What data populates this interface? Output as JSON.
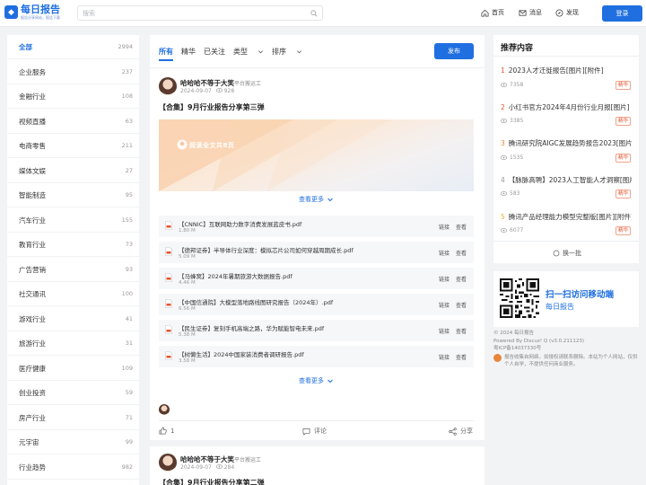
{
  "header": {
    "logo_text": "每日报告",
    "logo_sub": "报告分享网站，报告下载",
    "search_placeholder": "搜索",
    "nav": [
      {
        "label": "首页"
      },
      {
        "label": "消息"
      },
      {
        "label": "发现"
      }
    ],
    "login_label": "登录"
  },
  "sidebar": {
    "items": [
      {
        "label": "全部",
        "count": "2994",
        "active": true
      },
      {
        "label": "企业服务",
        "count": "237"
      },
      {
        "label": "金融行业",
        "count": "108"
      },
      {
        "label": "视频直播",
        "count": "63"
      },
      {
        "label": "电商零售",
        "count": "211"
      },
      {
        "label": "媒体文娱",
        "count": "27"
      },
      {
        "label": "智能制造",
        "count": "95"
      },
      {
        "label": "汽车行业",
        "count": "155"
      },
      {
        "label": "教育行业",
        "count": "73"
      },
      {
        "label": "广告营销",
        "count": "93"
      },
      {
        "label": "社交通讯",
        "count": "100"
      },
      {
        "label": "游戏行业",
        "count": "41"
      },
      {
        "label": "旅游行业",
        "count": "31"
      },
      {
        "label": "医疗健康",
        "count": "109"
      },
      {
        "label": "创业投资",
        "count": "59"
      },
      {
        "label": "房产行业",
        "count": "71"
      },
      {
        "label": "元宇宙",
        "count": "99"
      },
      {
        "label": "行业趋势",
        "count": "982"
      }
    ]
  },
  "feed": {
    "tabs": [
      {
        "label": "所有"
      },
      {
        "label": "精华"
      },
      {
        "label": "已关注"
      },
      {
        "label": "类型"
      },
      {
        "label": "排序"
      }
    ],
    "publish_label": "发布",
    "post1": {
      "author": "哈哈哈不等于大笑",
      "role": "平台搬运工",
      "date": "2024-09-07",
      "views": "928",
      "title": "【合集】9月行业报告分享第三弹",
      "banner_text": "阅读全文共8页",
      "more_label": "查看更多",
      "files": [
        {
          "name": "【CNNIC】互联网助力数字消费发展蓝皮书.pdf",
          "size": "1.80 M"
        },
        {
          "name": "【德邦证券】半导体行业深度：模拟芯片公司如何穿越周期成长.pdf",
          "size": "5.09 M"
        },
        {
          "name": "【马蜂窝】2024年暑期旅游大数据报告.pdf",
          "size": "4.46 M"
        },
        {
          "name": "【中国信通院】大模型落地路线图研究报告（2024年）.pdf",
          "size": "6.56 M"
        },
        {
          "name": "【民生证券】复刻手机高端之路，华为赋能智电未来.pdf",
          "size": "5.38 M"
        },
        {
          "name": "【树懒生活】2024中国家装消费者调研报告.pdf",
          "size": "3.58 M"
        }
      ],
      "link_label": "链接",
      "view_label": "查看",
      "files_more_label": "查看更多",
      "likes": "1",
      "comment_label": "评论",
      "share_label": "分享"
    },
    "post2": {
      "author": "哈哈哈不等于大笑",
      "role": "平台搬运工",
      "date": "2024-09-07",
      "views": "284",
      "title": "【合集】9月行业报告分享第二弹"
    }
  },
  "recommend": {
    "heading": "推荐内容",
    "items": [
      {
        "num": "1",
        "title": "2023人才迁徙报告[图片][附件]",
        "views": "7358",
        "tag": "精华"
      },
      {
        "num": "2",
        "title": "小红书官方2024年4月份行业月报[图片]",
        "views": "3385",
        "tag": "精华"
      },
      {
        "num": "3",
        "title": "腾讯研究院AIGC发展趋势报告2023[图片]",
        "views": "1535",
        "tag": "精华"
      },
      {
        "num": "4",
        "title": "【脉脉高聘】2023人工智能人才洞察[图片]",
        "views": "583",
        "tag": "精华"
      },
      {
        "num": "5",
        "title": "腾讯产品经理能力模型完整版[图片][附件]",
        "views": "6077",
        "tag": "精华"
      }
    ],
    "refresh_label": "换一批",
    "num_colors": [
      "#e5532d",
      "#e5532d",
      "#e58a2d",
      "#999999",
      "#e5b52d"
    ]
  },
  "qr": {
    "line1": "扫一扫访问移动端",
    "line2": "每日报告"
  },
  "footer": {
    "copyright": "© 2024 每日报告",
    "powered": "Powered By Discuz! Q (v3.0.211123)",
    "icp": "粤ICP备14037330号",
    "disclaimer": "报告收集自网络，如侵权请联系删除。本站为个人网站，仅供个人自学，不提供任何商业服务。"
  }
}
